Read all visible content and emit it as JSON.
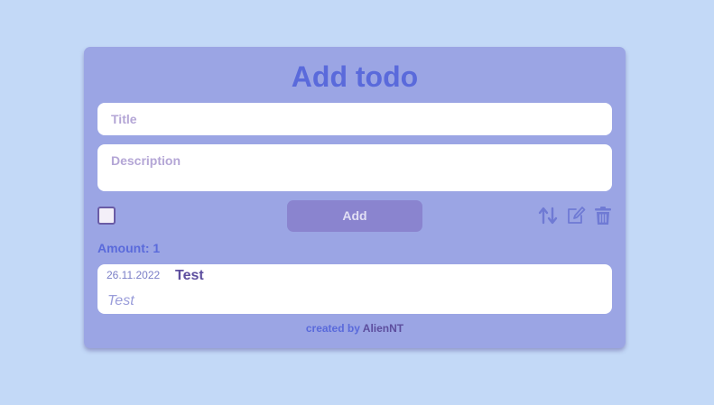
{
  "form": {
    "heading": "Add todo",
    "title_placeholder": "Title",
    "description_placeholder": "Description",
    "add_label": "Add",
    "checkbox_checked": false
  },
  "toolbar": {
    "icons": [
      "sort-arrows-icon",
      "edit-icon",
      "trash-icon"
    ]
  },
  "summary": {
    "amount_text": "Amount: 1"
  },
  "todos": [
    {
      "date": "26.11.2022",
      "title": "Test",
      "description": "Test"
    }
  ],
  "footer": {
    "prefix": "created by",
    "author": "AlienNT"
  },
  "colors": {
    "background": "#c3d9f7",
    "card": "#9ba5e4",
    "accent": "#5a6adb",
    "button": "#8a84cf",
    "dark_purple": "#5d4e9e"
  }
}
